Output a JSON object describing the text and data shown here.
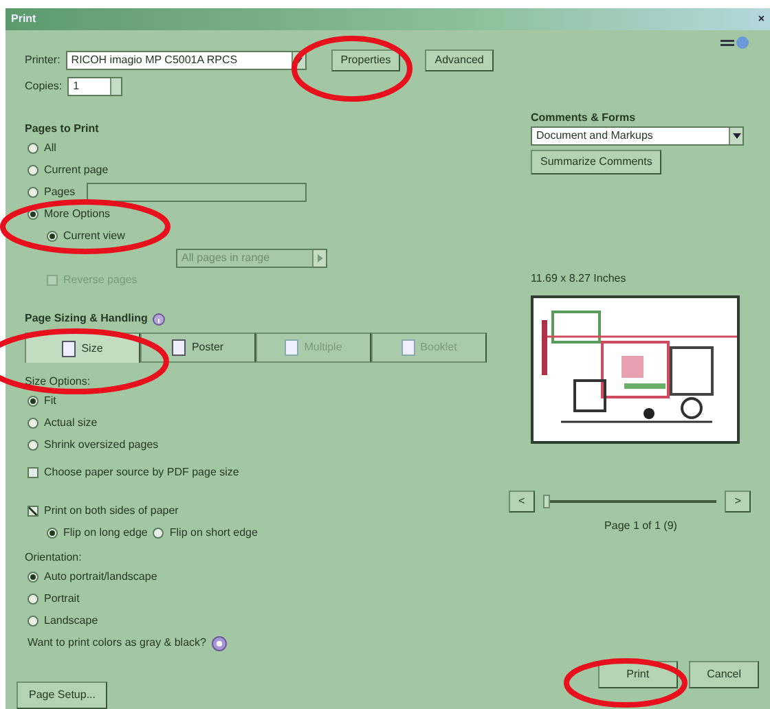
{
  "window": {
    "title": "Print",
    "close": "×"
  },
  "printer": {
    "label": "Printer:",
    "value": "RICOH imagio MP C5001A RPCS",
    "properties": "Properties",
    "advanced": "Advanced"
  },
  "copies": {
    "label": "Copies:",
    "value": "1"
  },
  "pages_to_print": {
    "title": "Pages to Print",
    "options": [
      {
        "label": "All",
        "selected": false
      },
      {
        "label": "Current page",
        "selected": false
      },
      {
        "label": "Pages",
        "selected": false,
        "kind": "field"
      },
      {
        "label": "More Options",
        "selected": true
      }
    ],
    "sub_option": {
      "label": "Current view",
      "selected": true
    },
    "range": {
      "value": "All pages in range",
      "disabled": true
    },
    "reverse": {
      "label": "Reverse pages",
      "checked": false,
      "disabled": true
    }
  },
  "sizing": {
    "title": "Page Sizing & Handling",
    "tabs": [
      {
        "label": "Size",
        "selected": true,
        "disabled": false
      },
      {
        "label": "Poster",
        "selected": false,
        "disabled": false
      },
      {
        "label": "Multiple",
        "selected": false,
        "disabled": true
      },
      {
        "label": "Booklet",
        "selected": false,
        "disabled": true
      }
    ],
    "options_title": "Size Options:",
    "options": [
      {
        "label": "Fit",
        "selected": true
      },
      {
        "label": "Actual size",
        "selected": false
      },
      {
        "label": "Shrink oversized pages",
        "selected": false
      }
    ],
    "paper_source": {
      "label": "Choose paper source by PDF page size",
      "checked": false
    }
  },
  "duplex": {
    "label": "Print on both sides of paper",
    "checked": true,
    "options": [
      {
        "label": "Flip on long edge",
        "selected": true
      },
      {
        "label": "Flip on short edge",
        "selected": false
      }
    ]
  },
  "orientation": {
    "title": "Orientation:",
    "options": [
      {
        "label": "Auto portrait/landscape",
        "selected": true
      },
      {
        "label": "Portrait",
        "selected": false
      },
      {
        "label": "Landscape",
        "selected": false
      }
    ]
  },
  "gray_question": "Want to print colors as gray & black?",
  "comments": {
    "title": "Comments & Forms",
    "value": "Document and Markups",
    "summarize": "Summarize Comments"
  },
  "preview": {
    "size": "11.69 x 8.27 Inches",
    "prev": "<",
    "next": ">",
    "level": 0.0,
    "page": "Page 1 of 1 (9)"
  },
  "footer": {
    "page_setup": "Page Setup...",
    "print": "Print",
    "cancel": "Cancel"
  },
  "annotation_circles": [
    {
      "color": "#e8101c"
    },
    {
      "color": "#e8101c"
    },
    {
      "color": "#e8101c"
    },
    {
      "color": "#e8101c"
    }
  ]
}
